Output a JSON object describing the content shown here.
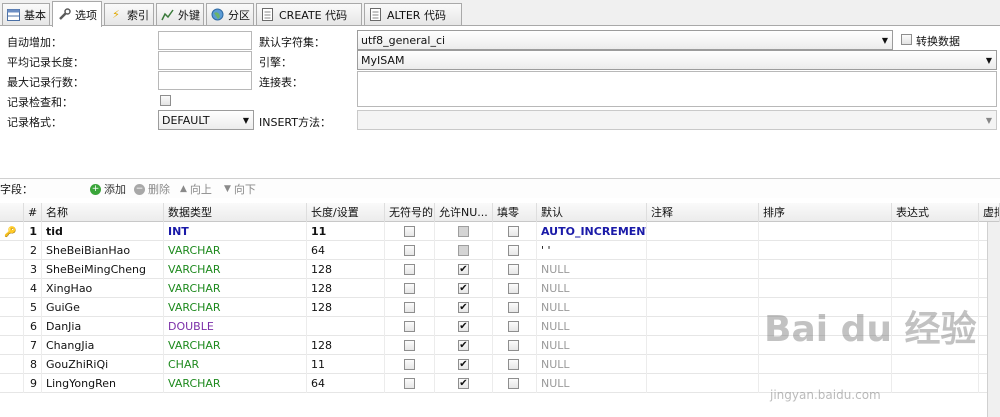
{
  "tabs": [
    {
      "label": "基本",
      "icon": "table-icon"
    },
    {
      "label": "选项",
      "icon": "wrench-icon",
      "active": true
    },
    {
      "label": "索引",
      "icon": "lightning-icon"
    },
    {
      "label": "外键",
      "icon": "chart-icon"
    },
    {
      "label": "分区",
      "icon": "globe-icon"
    },
    {
      "label": "CREATE 代码",
      "icon": "document-icon"
    },
    {
      "label": "ALTER 代码",
      "icon": "document-icon"
    }
  ],
  "options": {
    "auto_increment_label": "自动增加：",
    "avg_row_length_label": "平均记录长度：",
    "max_rows_label": "最大记录行数：",
    "checksum_label": "记录检查和：",
    "row_format_label": "记录格式：",
    "row_format_value": "DEFAULT",
    "charset_label": "默认字符集：",
    "charset_value": "utf8_general_ci",
    "convert_label": "转换数据",
    "engine_label": "引擎：",
    "engine_value": "MyISAM",
    "connection_label": "连接表：",
    "insert_method_label": "INSERT方法："
  },
  "fields_bar": {
    "label": "字段：",
    "add": "添加",
    "delete": "删除",
    "up": "向上",
    "down": "向下"
  },
  "columns": [
    "#",
    "名称",
    "数据类型",
    "长度/设置",
    "无符号的",
    "允许NU...",
    "填零",
    "默认",
    "注释",
    "排序",
    "表达式",
    "虚拟"
  ],
  "rows": [
    {
      "n": "1",
      "name": "tid",
      "type": "INT",
      "len": "11",
      "unsigned": false,
      "nullable": false,
      "zerofill": false,
      "default": "AUTO_INCREMENT",
      "key": true
    },
    {
      "n": "2",
      "name": "SheBeiBianHao",
      "type": "VARCHAR",
      "len": "64",
      "unsigned": false,
      "nullable": false,
      "zerofill": false,
      "default": "' '"
    },
    {
      "n": "3",
      "name": "SheBeiMingCheng",
      "type": "VARCHAR",
      "len": "128",
      "unsigned": false,
      "nullable": true,
      "zerofill": false,
      "default": "NULL"
    },
    {
      "n": "4",
      "name": "XingHao",
      "type": "VARCHAR",
      "len": "128",
      "unsigned": false,
      "nullable": true,
      "zerofill": false,
      "default": "NULL"
    },
    {
      "n": "5",
      "name": "GuiGe",
      "type": "VARCHAR",
      "len": "128",
      "unsigned": false,
      "nullable": true,
      "zerofill": false,
      "default": "NULL"
    },
    {
      "n": "6",
      "name": "DanJia",
      "type": "DOUBLE",
      "len": "",
      "unsigned": false,
      "nullable": true,
      "zerofill": false,
      "default": "NULL"
    },
    {
      "n": "7",
      "name": "ChangJia",
      "type": "VARCHAR",
      "len": "128",
      "unsigned": false,
      "nullable": true,
      "zerofill": false,
      "default": "NULL"
    },
    {
      "n": "8",
      "name": "GouZhiRiQi",
      "type": "CHAR",
      "len": "11",
      "unsigned": false,
      "nullable": true,
      "zerofill": false,
      "default": "NULL"
    },
    {
      "n": "9",
      "name": "LingYongRen",
      "type": "VARCHAR",
      "len": "64",
      "unsigned": false,
      "nullable": true,
      "zerofill": false,
      "default": "NULL"
    }
  ],
  "colors": {
    "int": "#1a1aa8",
    "varchar": "#1e8a1e",
    "double": "#7b2fa8",
    "char": "#1e8a1e",
    "auto_increment": "#1a1aa8",
    "null": "#9a9a9a"
  },
  "watermark": {
    "brand": "Bai du 经验",
    "url": "jingyan.baidu.com"
  }
}
